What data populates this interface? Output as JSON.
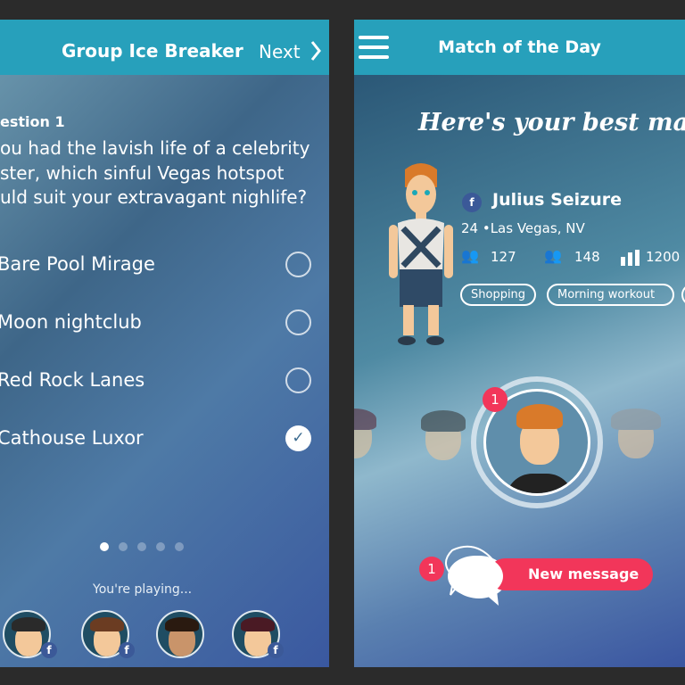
{
  "left_screen": {
    "header": {
      "title": "Group Ice Breaker",
      "next_label": "Next",
      "next_icon": "chevron-right-icon"
    },
    "question_label": "estion 1",
    "question_lines": [
      "ou had the lavish life of a celebrity",
      "ster, which sinful Vegas hotspot",
      "uld suit your extravagant nighlife?"
    ],
    "options": [
      {
        "label": "Bare Pool Mirage",
        "selected": false
      },
      {
        "label": "Moon nightclub",
        "selected": false
      },
      {
        "label": "Red Rock Lanes",
        "selected": false
      },
      {
        "label": "Cathouse Luxor",
        "selected": true
      }
    ],
    "check_glyph": "✓",
    "pagination": {
      "total": 5,
      "current": 1
    },
    "playing_label": "You're playing...",
    "players": [
      {
        "facebook": true
      },
      {
        "facebook": true
      },
      {
        "facebook": false
      },
      {
        "facebook": true
      }
    ],
    "fb_glyph": "f"
  },
  "right_screen": {
    "header": {
      "title": "Match of the Day",
      "menu_icon": "hamburger-icon"
    },
    "headline": "Here's your best match!",
    "match": {
      "name": "Julius Seizure",
      "age_location": "24 •Las Vegas, NV",
      "stats": [
        "127",
        "148",
        "1200"
      ],
      "tags": [
        "Shopping",
        "Morning workout"
      ]
    },
    "carousel_badge": "1",
    "message_badge": "1",
    "new_message_label": "New message"
  },
  "colors": {
    "header": "#27a0bb",
    "accent": "#f2365a",
    "facebook": "#3b5998"
  }
}
